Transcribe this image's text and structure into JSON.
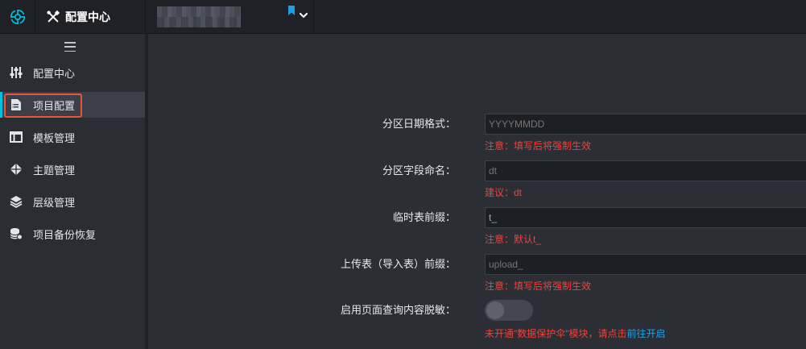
{
  "header": {
    "app_title": "配置中心",
    "project_name_redacted": "",
    "brand_color": "#00c1de",
    "icons": [
      "logo-icon",
      "tools-icon",
      "bookmark-icon",
      "chevron-down-icon"
    ]
  },
  "sidebar": {
    "menu_icon": "hamburger-icon",
    "items": [
      {
        "label": "配置中心",
        "icon": "sliders-icon",
        "active": false
      },
      {
        "label": "项目配置",
        "icon": "document-icon",
        "active": true
      },
      {
        "label": "模板管理",
        "icon": "template-icon",
        "active": false
      },
      {
        "label": "主题管理",
        "icon": "diamond-icon",
        "active": false
      },
      {
        "label": "层级管理",
        "icon": "layers-icon",
        "active": false
      },
      {
        "label": "项目备份恢复",
        "icon": "database-icon",
        "active": false
      }
    ]
  },
  "form": {
    "partition_date_format": {
      "label": "分区日期格式：",
      "placeholder": "YYYYMMDD",
      "hint": "注意：填写后将强制生效"
    },
    "partition_field_name": {
      "label": "分区字段命名：",
      "placeholder": "dt",
      "hint": "建议：dt"
    },
    "temp_table_prefix": {
      "label": "临时表前缀：",
      "value": "t_",
      "hint": "注意：默认t_"
    },
    "upload_table_prefix": {
      "label": "上传表（导入表）前缀：",
      "placeholder": "upload_",
      "hint": "注意：填写后将强制生效"
    },
    "desensitize": {
      "label": "启用页面查询内容脱敏：",
      "enabled": false,
      "hint_text": "未开通\"数据保护伞\"模块，请点击",
      "hint_link": "前往开启"
    }
  },
  "colors": {
    "hint_red": "#f0423a",
    "link_blue": "#1ea0e6",
    "active_outline": "#e8553d"
  }
}
